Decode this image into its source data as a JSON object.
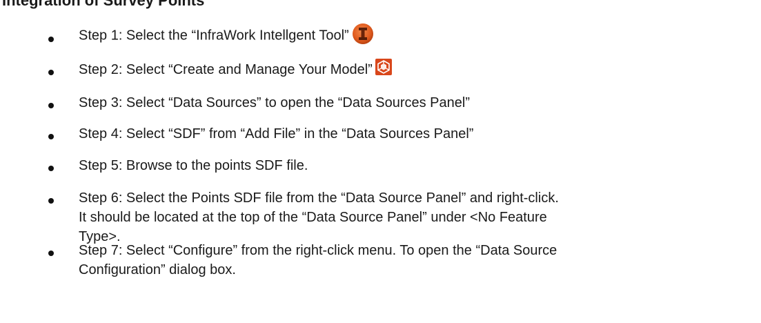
{
  "heading": "Integration of Survey Points",
  "steps": [
    {
      "prefix": "Step 1: Select the “InfraWork Intellgent Tool”",
      "icon": "infraworks-i-icon"
    },
    {
      "prefix": "Step 2: Select “Create and Manage Your Model”",
      "icon": "create-manage-model-icon"
    },
    {
      "text": "Step 3: Select “Data Sources” to open the “Data Sources Panel”"
    },
    {
      "text": "Step 4: Select “SDF” from “Add File” in the “Data Sources Panel”"
    },
    {
      "text": "Step 5: Browse to the points SDF file."
    },
    {
      "text": "Step 6: Select the Points SDF file from the “Data Source Panel” and right-click. It should be located at the top of the “Data Source Panel” under <No Feature Type>."
    },
    {
      "text": "Step 7: Select “Configure” from the right-click menu. To open the “Data Source Configuration” dialog box."
    }
  ]
}
